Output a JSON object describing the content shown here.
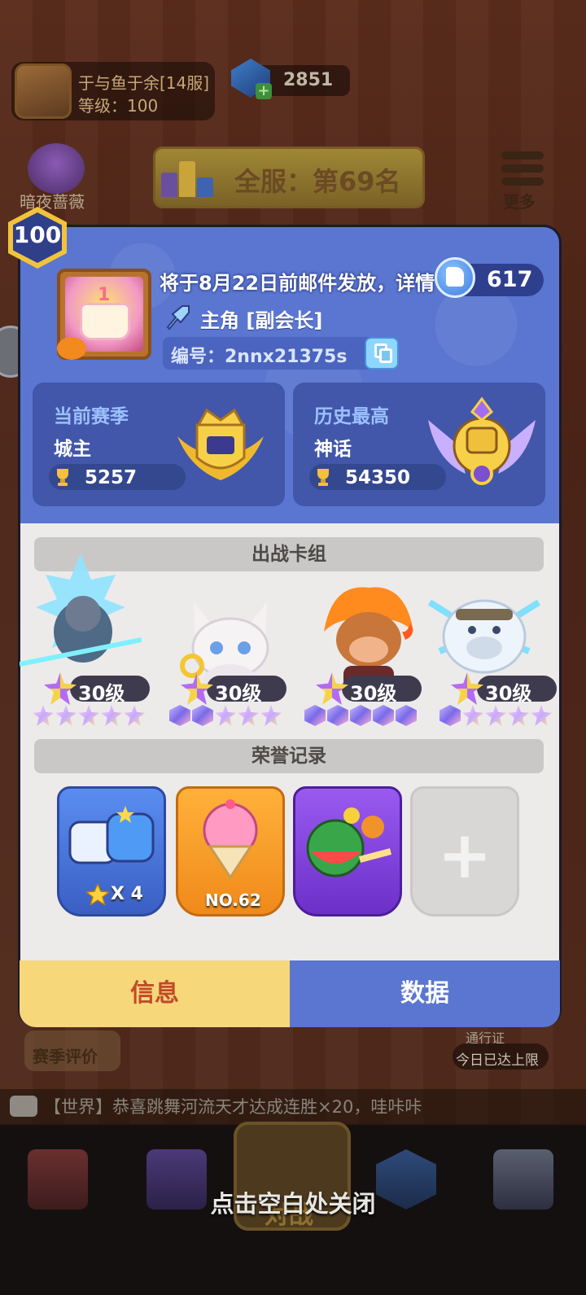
{
  "background": {
    "player_name": "于与鱼于余[14服]",
    "player_level": "等级：100",
    "gems": "2851",
    "hero_label": "暗夜蔷薇",
    "rank_banner": "全服：第69名",
    "more_label": "更多",
    "season_eval": "赛季评价",
    "pass_label": "通行证",
    "pass_status": "今日已达上限",
    "chat_text": "【世界】恭喜跳舞河流天才达成连胜×20，哇咔咔",
    "battle_label": "对战",
    "nav_icons": [
      "shop-icon",
      "cards-icon",
      "battle-icon",
      "clan-icon",
      "events-icon"
    ]
  },
  "dialog": {
    "level_badge": "100",
    "marquee": "将于8月22日前邮件发放，详情",
    "likes": "617",
    "role": "主角 [副会长]",
    "player_id": "编号：2nnx21375s",
    "current_season": {
      "title": "当前赛季",
      "rank": "城主",
      "trophies": "5257"
    },
    "history_best": {
      "title": "历史最高",
      "rank": "神话",
      "trophies": "54350"
    },
    "deck_title": "出战卡组",
    "deck": [
      {
        "name": "ice-lord-hero",
        "level": "30级",
        "stars": [
          "star",
          "star",
          "star",
          "star",
          "star"
        ]
      },
      {
        "name": "white-cat-hero",
        "level": "30级",
        "stars": [
          "cube",
          "cube",
          "star",
          "star",
          "star"
        ]
      },
      {
        "name": "fire-monkey-hero",
        "level": "30级",
        "stars": [
          "cube",
          "cube",
          "cube",
          "cube",
          "cube"
        ]
      },
      {
        "name": "ice-yeti-hero",
        "level": "30级",
        "stars": [
          "cube",
          "star",
          "star",
          "star",
          "star"
        ]
      }
    ],
    "honor_title": "荣誉记录",
    "honors": [
      {
        "name": "blue-slime-honor",
        "label": "X 4"
      },
      {
        "name": "ice-cream-honor",
        "label": "NO.62"
      },
      {
        "name": "watermelon-honor",
        "label": ""
      },
      {
        "name": "add-honor",
        "label": "+"
      }
    ],
    "tabs": {
      "info": "信息",
      "data": "数据"
    }
  },
  "close_hint": "点击空白处关闭",
  "colors": {
    "dialog_header": "#5a76d0",
    "card_bg": "#4257a9",
    "tab_active": "#f6d77a",
    "tab_inactive": "#5a76d0"
  }
}
